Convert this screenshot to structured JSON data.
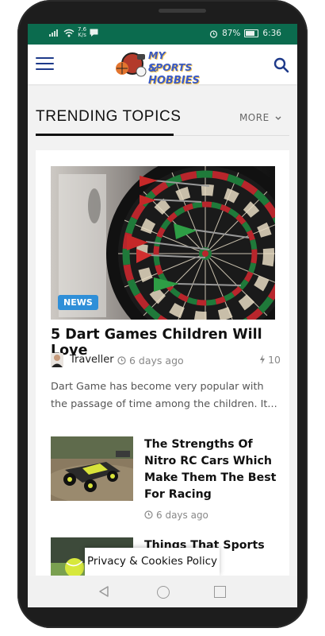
{
  "status": {
    "speed_value": "7.6",
    "speed_unit": "K/s",
    "battery": "87%",
    "time": "6:36"
  },
  "app": {
    "logo_line1": "MY SPORTS",
    "logo_line2": "& HOBBIES",
    "menu_icon": "hamburger-icon",
    "search_icon": "search-icon"
  },
  "section": {
    "title": "TRENDING TOPICS",
    "more_label": "MORE",
    "more_icon": "chevron-down-icon"
  },
  "featured": {
    "category": "NEWS",
    "title": "5 Dart Games Children Will Love",
    "author": "Traveller",
    "date": "6 days ago",
    "views": "10",
    "excerpt": "Dart Game has become very popular with the passage of time among the children. It..."
  },
  "articles": [
    {
      "title": "The Strengths Of Nitro RC Cars Which Make Them The Best For Racing",
      "date": "6 days ago"
    },
    {
      "title": "Things That Sports Lovers Should Be Aware Of Before Buying...",
      "title_visible": "Things That Sports"
    }
  ],
  "cookie": {
    "label": "Privacy & Cookies Policy"
  },
  "colors": {
    "statusbar": "#0b6b4e",
    "brand_blue": "#1e3a8a",
    "badge": "#2f8fd8"
  }
}
